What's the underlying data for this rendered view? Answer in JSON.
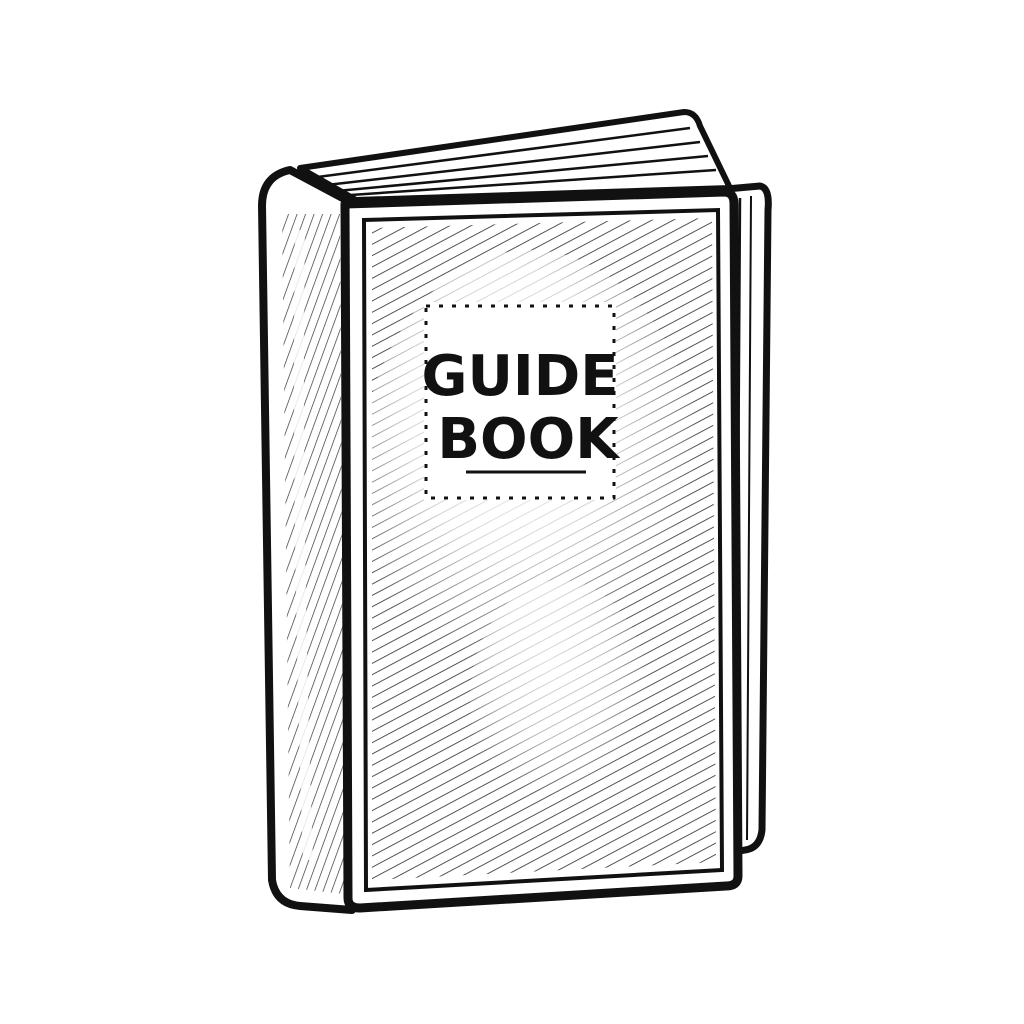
{
  "book": {
    "label_line1": "GUIDE",
    "label_line2": "BOOK"
  },
  "colors": {
    "ink": "#111111",
    "paper": "#ffffff"
  }
}
